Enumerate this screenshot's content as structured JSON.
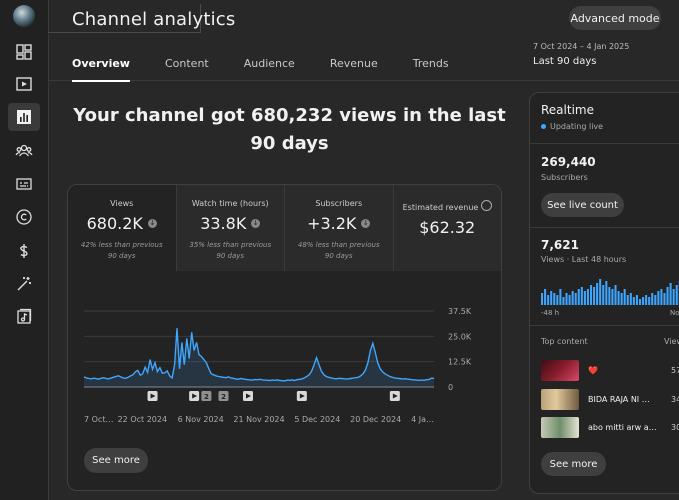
{
  "header": {
    "title": "Channel analytics",
    "advanced_mode": "Advanced mode",
    "date_range": "7 Oct 2024 – 4 Jan 2025",
    "period": "Last 90 days"
  },
  "tabs": [
    {
      "label": "Overview",
      "active": true
    },
    {
      "label": "Content"
    },
    {
      "label": "Audience"
    },
    {
      "label": "Revenue"
    },
    {
      "label": "Trends"
    }
  ],
  "sidebar": {
    "icons": [
      "dashboard-icon",
      "content-icon",
      "analytics-icon",
      "community-icon",
      "subtitles-icon",
      "copyright-icon",
      "earn-icon",
      "customization-icon",
      "audio-library-icon"
    ],
    "active_index": 2
  },
  "headline": "Your channel got 680,232 views in the last 90 days",
  "metrics": [
    {
      "label": "Views",
      "value": "680.2K",
      "sub": "42% less than previous 90 days",
      "trend": "down"
    },
    {
      "label": "Watch time (hours)",
      "value": "33.8K",
      "sub": "35% less than previous 90 days",
      "trend": "down"
    },
    {
      "label": "Subscribers",
      "value": "+3.2K",
      "sub": "48% less than previous 90 days",
      "trend": "down"
    },
    {
      "label": "Estimated revenue",
      "value": "$62.32",
      "sub": "",
      "trend": ""
    }
  ],
  "see_more": "See more",
  "chart_data": {
    "type": "area",
    "y_ticks": [
      "37.5K",
      "25.0K",
      "12.5K",
      "0"
    ],
    "ylim": [
      0,
      37500
    ],
    "x_labels": [
      "7 Oct…",
      "22 Oct 2024",
      "6 Nov 2024",
      "21 Nov 2024",
      "5 Dec 2024",
      "20 Dec 2024",
      "4 Ja…"
    ],
    "values": [
      5000,
      4500,
      4200,
      4000,
      4400,
      4100,
      3900,
      4300,
      4600,
      4200,
      4000,
      4400,
      4800,
      5200,
      5600,
      5000,
      4500,
      4300,
      4800,
      5500,
      6000,
      7500,
      8200,
      5800,
      6500,
      9800,
      7200,
      13500,
      8800,
      12000,
      7600,
      9500,
      6800,
      7000,
      8000,
      5500,
      4500,
      11000,
      29000,
      9000,
      22000,
      11000,
      24000,
      14000,
      27000,
      18000,
      22000,
      16000,
      15000,
      13500,
      12000,
      9000,
      6500,
      6000,
      5500,
      5200,
      5000,
      4800,
      4600,
      5000,
      4500,
      4300,
      4000,
      3800,
      4200,
      4000,
      3800,
      3600,
      3500,
      3400,
      3700,
      3600,
      3800,
      3500,
      3400,
      3300,
      3200,
      3400,
      3300,
      3500,
      3200,
      3100,
      3000,
      3400,
      3300,
      3500,
      3200,
      3600,
      3800,
      4000,
      4500,
      5200,
      6000,
      7800,
      11000,
      14500,
      11000,
      7800,
      6000,
      5200,
      4800,
      4500,
      4200,
      4000,
      4300,
      4200,
      4100,
      4000,
      4000,
      4200,
      4400,
      4600,
      4800,
      5500,
      6500,
      8500,
      12000,
      18000,
      21500,
      17000,
      12000,
      9000,
      7500,
      6500,
      5800,
      5200,
      4800,
      4500,
      4300,
      4200,
      4000,
      4100,
      3900,
      3800,
      3600,
      3500,
      3400,
      3300,
      3400,
      3300,
      3600,
      3700,
      4400,
      4200
    ],
    "markers": [
      {
        "index": 28,
        "label": ""
      },
      {
        "index": 45,
        "label": ""
      },
      {
        "index": 50,
        "label": "2"
      },
      {
        "index": 57,
        "label": "2"
      },
      {
        "index": 67,
        "label": ""
      },
      {
        "index": 89,
        "label": ""
      },
      {
        "index": 127,
        "label": ""
      }
    ]
  },
  "realtime": {
    "title": "Realtime",
    "status": "Updating live",
    "subscribers": "269,440",
    "subscribers_label": "Subscribers",
    "see_live": "See live count",
    "views": "7,621",
    "views_label": "Views · Last 48 hours",
    "axis_left": "-48 h",
    "axis_right": "No",
    "bars": [
      6,
      8,
      5,
      7,
      6,
      5,
      8,
      4,
      6,
      5,
      7,
      6,
      8,
      9,
      7,
      8,
      10,
      9,
      11,
      13,
      10,
      12,
      9,
      8,
      10,
      7,
      6,
      8,
      5,
      6,
      4,
      5,
      3,
      4,
      5,
      4,
      6,
      5,
      7,
      8,
      6,
      9,
      11,
      8,
      10,
      12,
      9,
      7,
      10
    ],
    "top_content_label": "Top content",
    "views_col_label": "View",
    "top_content": [
      {
        "title": "❤️",
        "views": "57"
      },
      {
        "title": "BIDA RAJA NI …",
        "views": "34"
      },
      {
        "title": "abo mitti arw a…",
        "views": "30"
      }
    ],
    "see_more": "See more"
  }
}
